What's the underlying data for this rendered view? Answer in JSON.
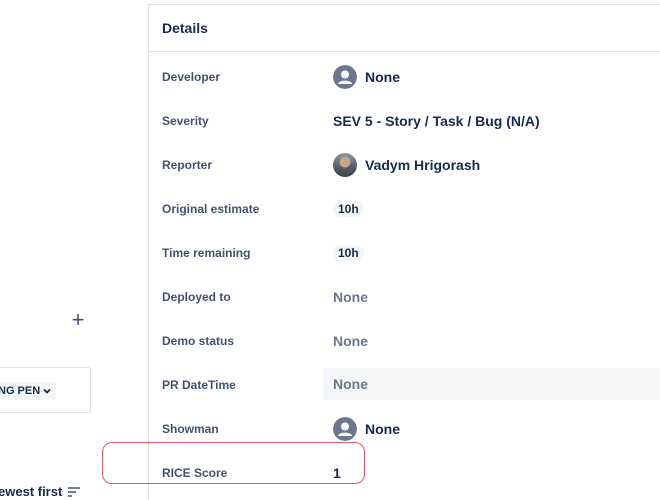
{
  "left": {
    "add_symbol": "+",
    "status": "NG PEN",
    "sort_label": "ewest first"
  },
  "details": {
    "title": "Details",
    "fields": {
      "developer": {
        "label": "Developer",
        "value": "None"
      },
      "severity": {
        "label": "Severity",
        "value": "SEV 5 - Story / Task / Bug (N/A)"
      },
      "reporter": {
        "label": "Reporter",
        "value": "Vadym Hrigorash"
      },
      "original_estimate": {
        "label": "Original estimate",
        "value": "10h"
      },
      "time_remaining": {
        "label": "Time remaining",
        "value": "10h"
      },
      "deployed_to": {
        "label": "Deployed to",
        "value": "None"
      },
      "demo_status": {
        "label": "Demo status",
        "value": "None"
      },
      "pr_datetime": {
        "label": "PR DateTime",
        "value": "None"
      },
      "showman": {
        "label": "Showman",
        "value": "None"
      },
      "rice_score": {
        "label": "RICE Score",
        "value": "1"
      }
    }
  },
  "colors": {
    "highlight": "#e05c6a",
    "text": "#172b4d",
    "muted": "#6b778c"
  }
}
